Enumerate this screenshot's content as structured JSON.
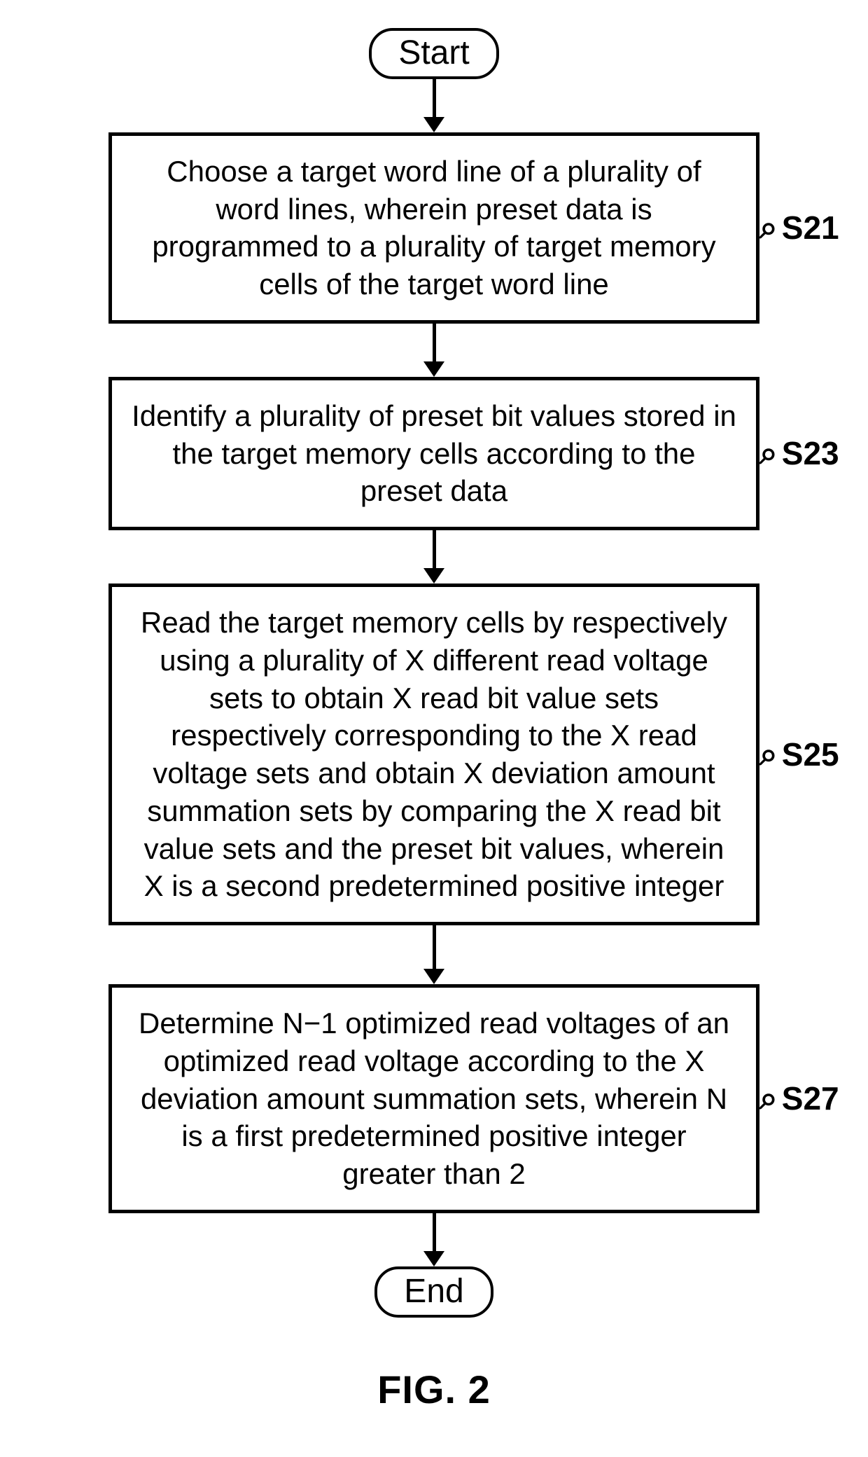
{
  "terminals": {
    "start": "Start",
    "end": "End"
  },
  "steps": [
    {
      "id": "S21",
      "text": "Choose a target word line of a plurality of word lines, wherein preset data  is programmed to a plurality of target memory cells of the target word line"
    },
    {
      "id": "S23",
      "text": "Identify a plurality of preset bit values stored in the target memory cells according to the preset data"
    },
    {
      "id": "S25",
      "text": "Read the target memory cells by respectively using a plurality of X different read voltage sets to obtain X read bit value sets respectively corresponding to the X read voltage sets and obtain X deviation amount summation sets by comparing the X read bit value sets and the preset bit values, wherein X is a second predetermined positive integer"
    },
    {
      "id": "S27",
      "text": "Determine N−1 optimized read voltages of an optimized read voltage according to the X deviation amount summation sets, wherein N is a first predetermined positive integer greater than 2"
    }
  ],
  "figure_caption": "FIG. 2"
}
